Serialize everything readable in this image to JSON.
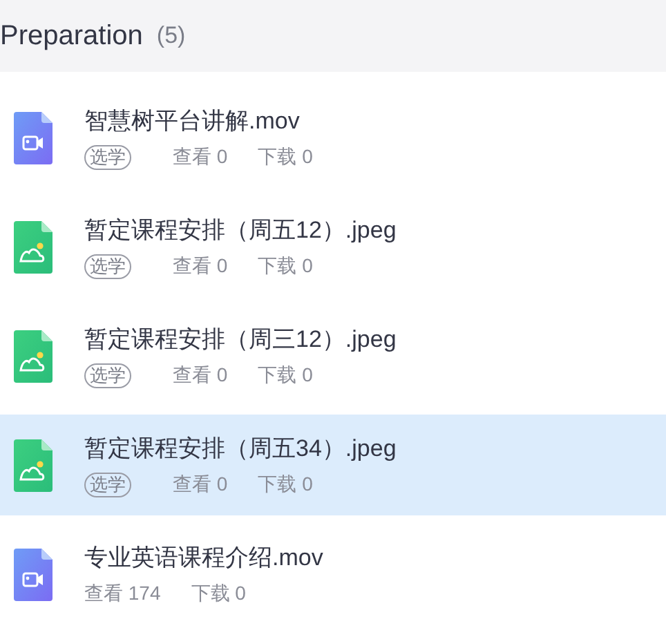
{
  "header": {
    "title": "Preparation",
    "count": "(5)"
  },
  "files": [
    {
      "kind": "video",
      "name": "智慧树平台讲解.mov",
      "tag": "选学",
      "views": "查看 0",
      "downloads": "下载 0",
      "selected": false
    },
    {
      "kind": "image",
      "name": "暂定课程安排（周五12）.jpeg",
      "tag": "选学",
      "views": "查看 0",
      "downloads": "下载 0",
      "selected": false
    },
    {
      "kind": "image",
      "name": "暂定课程安排（周三12）.jpeg",
      "tag": "选学",
      "views": "查看 0",
      "downloads": "下载 0",
      "selected": false
    },
    {
      "kind": "image",
      "name": "暂定课程安排（周五34）.jpeg",
      "tag": "选学",
      "views": "查看 0",
      "downloads": "下载 0",
      "selected": true
    },
    {
      "kind": "video",
      "name": "专业英语课程介绍.mov",
      "views": "查看 174",
      "downloads": "下载 0",
      "selected": false
    }
  ]
}
